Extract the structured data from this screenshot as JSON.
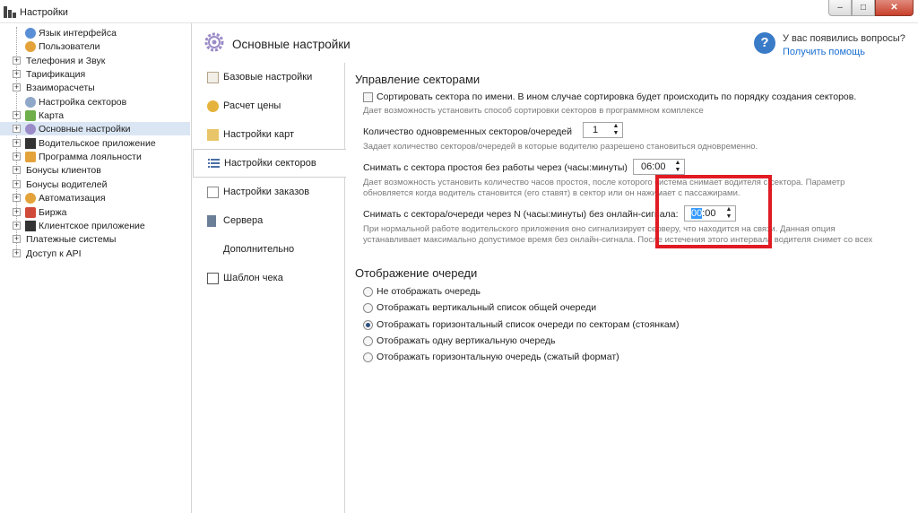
{
  "window": {
    "title": "Настройки",
    "buttons": {
      "minimize": "–",
      "maximize": "□",
      "close": "✕"
    }
  },
  "tree": [
    {
      "label": "Язык интерфейса",
      "icon": "globe-icon",
      "color": "#5a8fd6"
    },
    {
      "label": "Пользователи",
      "icon": "users-icon",
      "color": "#e4a23a"
    },
    {
      "label": "Телефония и Звук"
    },
    {
      "label": "Тарификация"
    },
    {
      "label": "Взаиморасчеты"
    },
    {
      "label": "Настройка секторов",
      "icon": "sectors-icon",
      "color": "#8fa7c8"
    },
    {
      "label": "Карта",
      "icon": "map-icon",
      "color": "#6eae4b"
    },
    {
      "label": "Основные настройки",
      "icon": "gear-icon",
      "color": "#9b8bc7"
    },
    {
      "label": "Водительское приложение",
      "icon": "qr-icon",
      "color": "#333333"
    },
    {
      "label": "Программа лояльности",
      "icon": "loyalty-icon",
      "color": "#e4a23a"
    },
    {
      "label": "Бонусы клиентов"
    },
    {
      "label": "Бонусы водителей"
    },
    {
      "label": "Автоматизация",
      "icon": "clock-icon",
      "color": "#e4a23a"
    },
    {
      "label": "Биржа",
      "icon": "exchange-icon",
      "color": "#d04a3c"
    },
    {
      "label": "Клиентское приложение",
      "icon": "qr-icon",
      "color": "#333333"
    },
    {
      "label": "Платежные системы"
    },
    {
      "label": "Доступ к API"
    }
  ],
  "header": {
    "title": "Основные настройки",
    "help_question": "У вас появились вопросы?",
    "help_link": "Получить помощь"
  },
  "submenu": [
    {
      "label": "Базовые настройки",
      "icon": "document-icon"
    },
    {
      "label": "Расчет цены",
      "icon": "coins-icon"
    },
    {
      "label": "Настройки карт",
      "icon": "map-card-icon"
    },
    {
      "label": "Настройки секторов",
      "icon": "list-icon"
    },
    {
      "label": "Настройки заказов",
      "icon": "orders-icon"
    },
    {
      "label": "Сервера",
      "icon": "server-icon"
    },
    {
      "label": "Дополнительно",
      "icon": ""
    },
    {
      "label": "Шаблон чека",
      "icon": "receipt-icon"
    }
  ],
  "sectors": {
    "title": "Управление секторами",
    "sort_label": "Сортировать сектора по имени. В ином случае сортировка будет происходить по порядку создания секторов.",
    "sort_hint": "Дает возможность установить способ сортировки секторов в программном комплексе",
    "count_label": "Количество одновременных секторов/очередей",
    "count_value": "1",
    "count_hint": "Задает количество секторов/очередей в которые водителю разрешено становиться одновременно.",
    "idle_label": "Снимать с сектора простоя без работы через (часы:минуты)",
    "idle_value": "06:00",
    "idle_hint_1": "Дает возможность установить количество часов простоя, после которого система снимает водителя с сектора. Параметр",
    "idle_hint_2": "обновляется когда водитель становится (его ставят) в сектор или он нажимает с пассажирами.",
    "offline_label": "Снимать с сектора/очереди через N (часы:минуты) без онлайн-сигнала:",
    "offline_value_sel": "00",
    "offline_value_rest": ":00",
    "offline_hint_1": "При нормальной работе водительского приложения оно сигнализирует серверу, что находится на связи. Данная опция",
    "offline_hint_2": "устанавливает максимально допустимое время без онлайн-сигнала. После истечения этого интервала водителя снимет со всех"
  },
  "queue": {
    "title": "Отображение очереди",
    "options": [
      "Не отображать очередь",
      "Отображать вертикальный список общей очереди",
      "Отображать горизонтальный список очереди по секторам (стоянкам)",
      "Отображать одну вертикальную очередь",
      "Отображать горизонтальную очередь (сжатый формат)"
    ],
    "selected_index": 2
  }
}
